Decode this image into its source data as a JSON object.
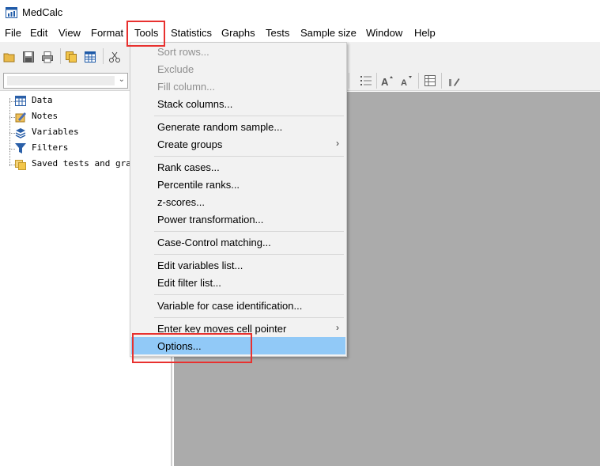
{
  "window": {
    "title": "MedCalc"
  },
  "menubar": {
    "items": [
      "File",
      "Edit",
      "View",
      "Format",
      "Tools",
      "Statistics",
      "Graphs",
      "Tests",
      "Sample size",
      "Window",
      "Help"
    ],
    "active": "Tools"
  },
  "tree": {
    "items": [
      {
        "label": "Data",
        "icon": "table-icon"
      },
      {
        "label": "Notes",
        "icon": "notes-icon"
      },
      {
        "label": "Variables",
        "icon": "variables-icon"
      },
      {
        "label": "Filters",
        "icon": "filter-icon"
      },
      {
        "label": "Saved tests and graph",
        "icon": "folder-icon"
      }
    ]
  },
  "tools_menu": {
    "items": [
      {
        "label": "Sort rows...",
        "disabled": true
      },
      {
        "label": "Exclude",
        "disabled": true
      },
      {
        "label": "Fill column...",
        "disabled": true
      },
      {
        "label": "Stack columns...",
        "disabled": false
      },
      {
        "label": "Generate random sample...",
        "disabled": false
      },
      {
        "label": "Create groups",
        "disabled": false,
        "submenu": true
      },
      {
        "label": "Rank cases...",
        "disabled": false
      },
      {
        "label": "Percentile ranks...",
        "disabled": false
      },
      {
        "label": "z-scores...",
        "disabled": false
      },
      {
        "label": "Power transformation...",
        "disabled": false
      },
      {
        "label": "Case-Control matching...",
        "disabled": false
      },
      {
        "label": "Edit variables list...",
        "disabled": false
      },
      {
        "label": "Edit filter list...",
        "disabled": false
      },
      {
        "label": "Variable for case identification...",
        "disabled": false
      },
      {
        "label": "Enter key moves cell pointer",
        "disabled": false,
        "submenu": true
      },
      {
        "label": "Options...",
        "disabled": false,
        "highlighted": true
      }
    ],
    "submenu_arrow": "›"
  },
  "colors": {
    "menu_highlight": "#91c9f7",
    "active_menu_bg": "#cce8ff",
    "workspace": "#ababab",
    "annotation_red": "#e8312f"
  }
}
